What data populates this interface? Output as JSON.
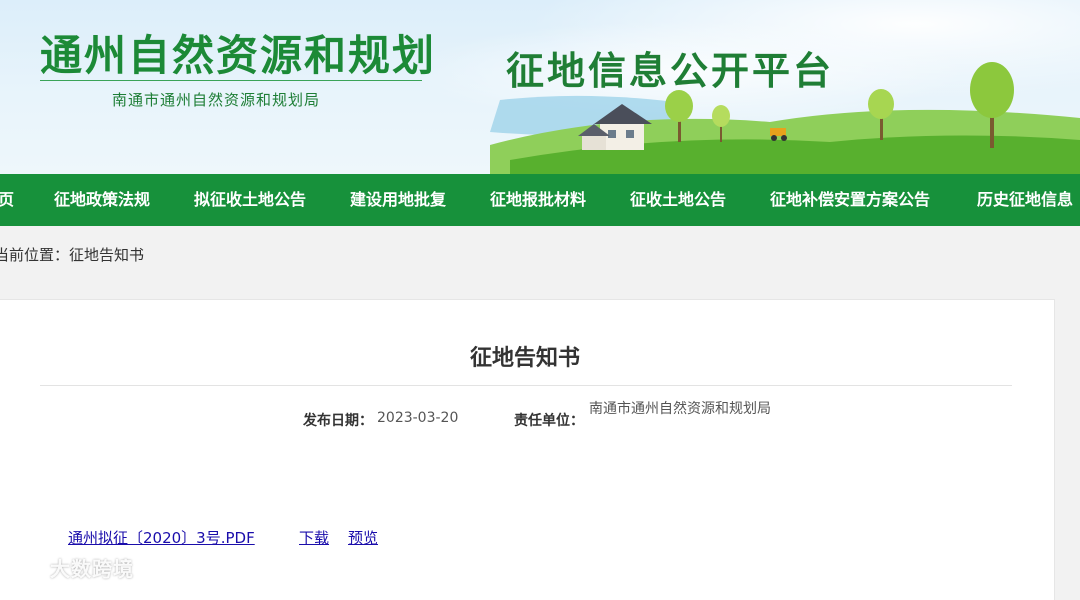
{
  "header": {
    "site_title": "通州自然资源和规划",
    "site_subtitle": "南通市通州自然资源和规划局",
    "platform_title": "征地信息公开平台"
  },
  "nav": {
    "items": [
      {
        "label": "页"
      },
      {
        "label": "征地政策法规"
      },
      {
        "label": "拟征收土地公告"
      },
      {
        "label": "建设用地批复"
      },
      {
        "label": "征地报批材料"
      },
      {
        "label": "征收土地公告"
      },
      {
        "label": "征地补偿安置方案公告"
      },
      {
        "label": "历史征地信息"
      }
    ]
  },
  "breadcrumb": {
    "prefix": "当前位置：",
    "current": "征地告知书"
  },
  "article": {
    "title": "征地告知书",
    "publish_date_label": "发布日期：",
    "publish_date": "2023-03-20",
    "unit_label": "责任单位：",
    "unit": "南通市通州自然资源和规划局"
  },
  "attachments": {
    "file_name": "通州拟征〔2020〕3号.PDF",
    "download_label": "下载",
    "preview_label": "预览"
  },
  "watermark": {
    "text": "大数跨境"
  },
  "colors": {
    "nav_green": "#17913b",
    "title_green": "#1c8a37",
    "link_blue": "#1a0dab"
  }
}
